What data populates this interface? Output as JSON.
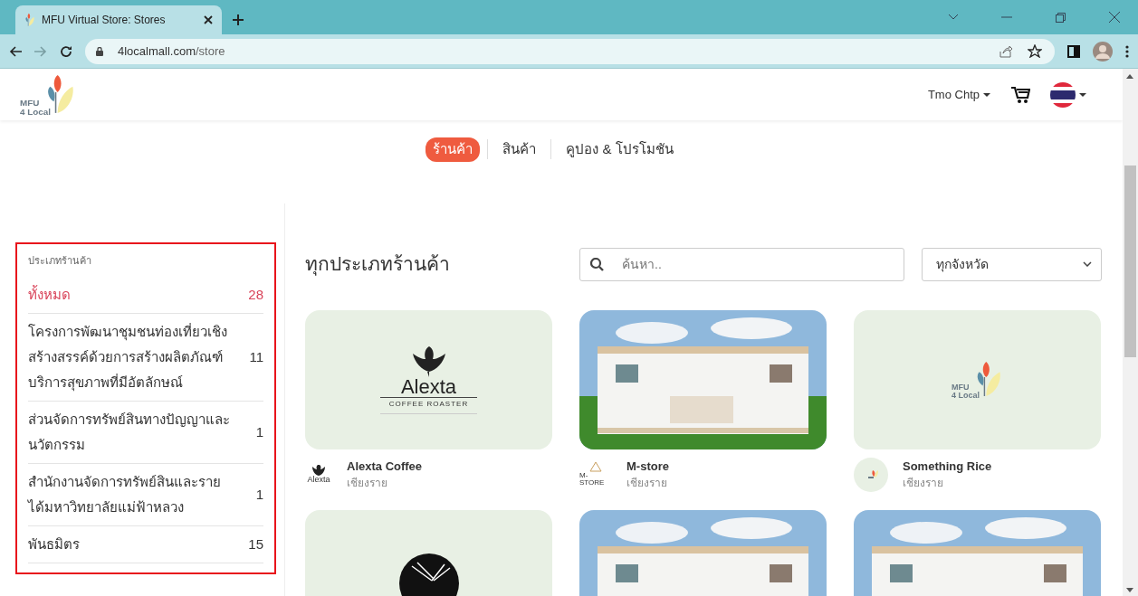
{
  "browser": {
    "tab": {
      "title": "MFU Virtual Store: Stores",
      "selected": true
    },
    "address": {
      "host": "4localmall.com",
      "path": "/store"
    }
  },
  "header": {
    "logo": {
      "line_1": "MFU",
      "line_2": "4 Local"
    },
    "user": "Tmo Chtp"
  },
  "nav": [
    {
      "label": "ร้านค้า",
      "selected": true
    },
    {
      "label": "สินค้า",
      "selected": false
    },
    {
      "label": "คูปอง & โปรโมชัน",
      "selected": false
    }
  ],
  "sidebar": {
    "title": "ประเภทร้านค้า",
    "highlighted": true,
    "items": [
      {
        "label": "ทั้งหมด",
        "count": "28",
        "selected": true
      },
      {
        "label": "โครงการพัฒนาชุมชนท่องเที่ยวเชิงสร้างสรรค์ด้วยการสร้างผลิตภัณฑ์บริการสุขภาพที่มีอัตลักษณ์",
        "count": "11",
        "selected": false
      },
      {
        "label": "ส่วนจัดการทรัพย์สินทางปัญญาและนวัตกรรม",
        "count": "1",
        "selected": false
      },
      {
        "label": "สำนักงานจัดการทรัพย์สินและรายได้มหาวิทยาลัยแม่ฟ้าหลวง",
        "count": "1",
        "selected": false
      },
      {
        "label": "พันธมิตร",
        "count": "15",
        "selected": false
      }
    ]
  },
  "main": {
    "heading": "ทุกประเภทร้านค้า",
    "search": {
      "placeholder": "ค้นหา.."
    },
    "province_select": {
      "value": "ทุกจังหวัด"
    },
    "stores": [
      {
        "media": {
          "kind": "alexta-logo",
          "text": "Alexta",
          "subtext": "COFFEE ROASTER"
        },
        "avatar": {
          "kind": "alexta",
          "text": "Alexta"
        },
        "name": "Alexta Coffee",
        "location": "เชียงราย"
      },
      {
        "media": {
          "kind": "picture"
        },
        "avatar": {
          "kind": "m-store",
          "text": "M-STORE"
        },
        "name": "M-store",
        "location": "เชียงราย"
      },
      {
        "media": {
          "kind": "mfu-logo",
          "line_1": "MFU",
          "line_2": "4 Local"
        },
        "avatar": {
          "kind": "rice"
        },
        "name": "Something Rice",
        "location": "เชียงราย"
      },
      {
        "media": {
          "kind": "circle-logo"
        }
      },
      {
        "media": {
          "kind": "picture"
        }
      },
      {
        "media": {
          "kind": "picture"
        }
      }
    ]
  }
}
